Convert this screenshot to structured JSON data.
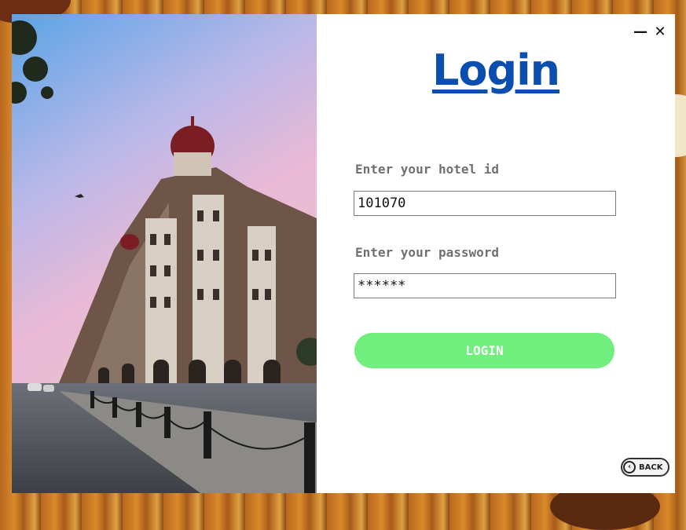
{
  "window": {
    "minimize_label": "—",
    "close_label": "✕"
  },
  "login": {
    "title": "Login",
    "hotel_id_label": "Enter your hotel id",
    "hotel_id_value": "101070",
    "password_label": "Enter your password",
    "password_value": "******",
    "login_button": "LOGIN",
    "back_button": "BACK"
  },
  "colors": {
    "title": "#0a4fb0",
    "login_button": "#70ef7e"
  },
  "icons": {
    "back": "chevron-left-circle-icon"
  }
}
